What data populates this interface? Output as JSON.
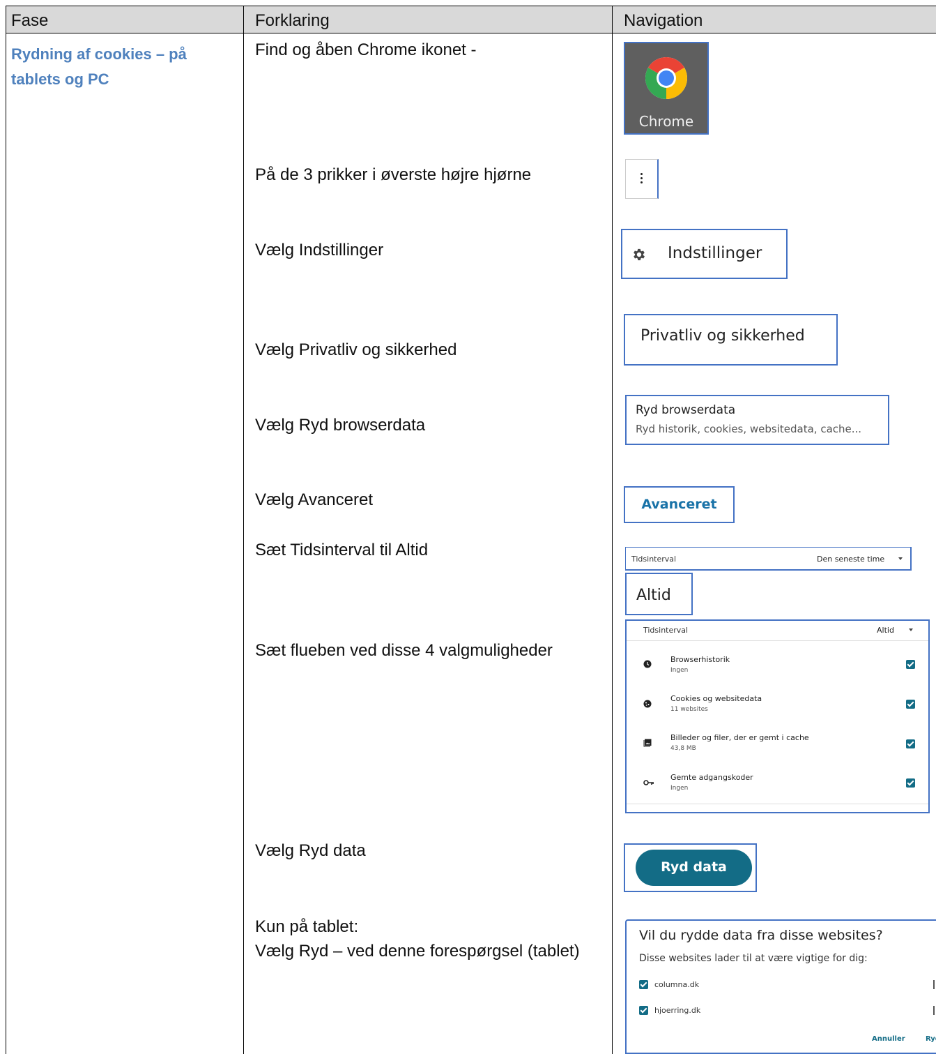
{
  "table": {
    "headers": {
      "phase": "Fase",
      "explanation": "Forklaring",
      "navigation": "Navigation"
    },
    "phase_title": "Rydning af cookies – på tablets og PC",
    "steps": {
      "s1": "Find og åben Chrome ikonet -",
      "s2": "På de 3 prikker i øverste højre hjørne",
      "s3": "Vælg Indstillinger",
      "s4": "Vælg Privatliv og sikkerhed",
      "s5": "Vælg Ryd browserdata",
      "s6": "Vælg Avanceret",
      "s7": "Sæt Tidsinterval til Altid",
      "s8": "Sæt flueben ved disse 4 valgmuligheder",
      "s9": "Vælg Ryd data",
      "s10_line1": "Kun på tablet:",
      "s10_line2": "Vælg Ryd – ved denne forespørgsel (tablet)"
    }
  },
  "nav": {
    "chrome_label": "Chrome",
    "settings_label": "Indstillinger",
    "privacy_label": "Privatliv og sikkerhed",
    "clear_title": "Ryd browserdata",
    "clear_sub": "Ryd historik, cookies, websitedata, cache...",
    "advanced_label": "Avanceret",
    "time_label": "Tidsinterval",
    "time_value": "Den seneste time",
    "always_label": "Altid",
    "options": {
      "time_label": "Tidsinterval",
      "time_value": "Altid",
      "rows": [
        {
          "title": "Browserhistorik",
          "sub": "Ingen",
          "icon": "clock-icon",
          "checked": true
        },
        {
          "title": "Cookies og websitedata",
          "sub": "11 websites",
          "icon": "cookie-icon",
          "checked": true
        },
        {
          "title": "Billeder og filer, der er gemt i cache",
          "sub": "43,8 MB",
          "icon": "image-icon",
          "checked": true
        },
        {
          "title": "Gemte adgangskoder",
          "sub": "Ingen",
          "icon": "key-icon",
          "checked": true
        }
      ]
    },
    "clear_data_button": "Ryd data",
    "dialog": {
      "title": "Vil du rydde data fra disse websites?",
      "subtitle": "Disse websites lader til at være vigtige for dig:",
      "sites": [
        "columna.dk",
        "hjoerring.dk"
      ],
      "cancel": "Annuller",
      "clear": "Ryd"
    },
    "colors": {
      "accent": "#136c86",
      "border": "#4472c4",
      "phase": "#4f81bd",
      "header_bg": "#d9d9d9"
    }
  }
}
